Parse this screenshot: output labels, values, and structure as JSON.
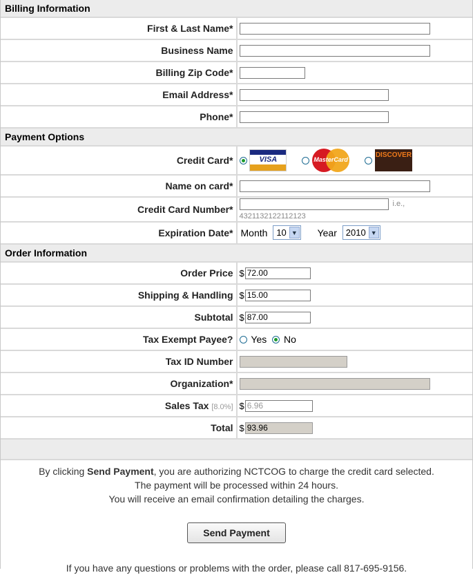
{
  "billing": {
    "title": "Billing Information",
    "name_label": "First & Last Name*",
    "business_label": "Business Name",
    "zip_label": "Billing Zip Code*",
    "email_label": "Email Address*",
    "phone_label": "Phone*"
  },
  "payment": {
    "title": "Payment Options",
    "card_label": "Credit Card*",
    "selected_card": "visa",
    "cards": [
      "visa",
      "mastercard",
      "discover"
    ],
    "card_logo_text": {
      "visa": "VISA",
      "mastercard": "MasterCard",
      "discover": "DISCOVER"
    },
    "name_on_card_label": "Name on card*",
    "number_label": "Credit Card Number*",
    "number_hint": "i.e., 4321132122112123",
    "expiration_label": "Expiration Date*",
    "month_label": "Month",
    "month_value": "10",
    "year_label": "Year",
    "year_value": "2010"
  },
  "order": {
    "title": "Order Information",
    "price_label": "Order Price",
    "price_value": "72.00",
    "shipping_label": "Shipping & Handling",
    "shipping_value": "15.00",
    "subtotal_label": "Subtotal",
    "subtotal_value": "87.00",
    "tax_exempt_label": "Tax Exempt Payee?",
    "tax_exempt_yes": "Yes",
    "tax_exempt_no": "No",
    "tax_exempt_value": "No",
    "tax_id_label": "Tax ID Number",
    "organization_label": "Organization*",
    "sales_tax_label": "Sales Tax",
    "sales_tax_rate": "[8.0%]",
    "sales_tax_value": "6.96",
    "total_label": "Total",
    "total_value": "93.96",
    "currency": "$"
  },
  "footer": {
    "line1_pre": "By clicking ",
    "line1_bold": "Send Payment",
    "line1_post": ", you are authorizing NCTCOG to charge the credit card selected.",
    "line2": "The payment will be processed within 24 hours.",
    "line3": "You will receive an email confirmation detailing the charges.",
    "send_button": "Send Payment",
    "contact": "If you have any questions or problems with the order, please call 817-695-9156."
  }
}
